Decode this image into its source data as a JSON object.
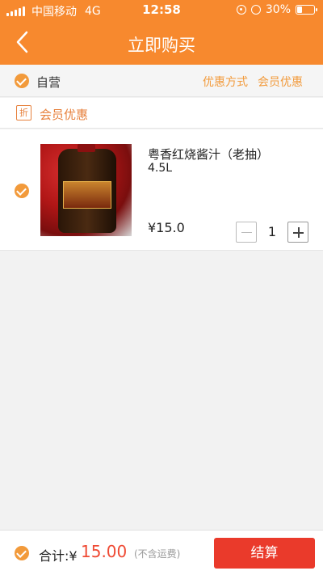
{
  "status_bar": {
    "carrier": "中国移动",
    "network": "4G",
    "time": "12:58",
    "battery": "30%",
    "battery_level": 0.3
  },
  "header": {
    "title": "立即购买",
    "back_icon": "chevron-left-icon"
  },
  "store": {
    "name": "自营",
    "discount_method": "优惠方式",
    "member_discount": "会员优惠"
  },
  "member_row": {
    "badge": "折",
    "label": "会员优惠"
  },
  "product": {
    "name": "粤香红烧酱汁（老抽）",
    "spec": "4.5L",
    "price": "¥15.0",
    "quantity": "1"
  },
  "footer": {
    "total_label": "合计:¥",
    "total_amount": "15.00",
    "shipping_note": "(不含运费)",
    "checkout_label": "结算"
  },
  "colors": {
    "header_bg": "#f7892e",
    "accent": "#f29a3b",
    "price_red": "#ef4a34",
    "checkout_red": "#ea3a2b"
  }
}
